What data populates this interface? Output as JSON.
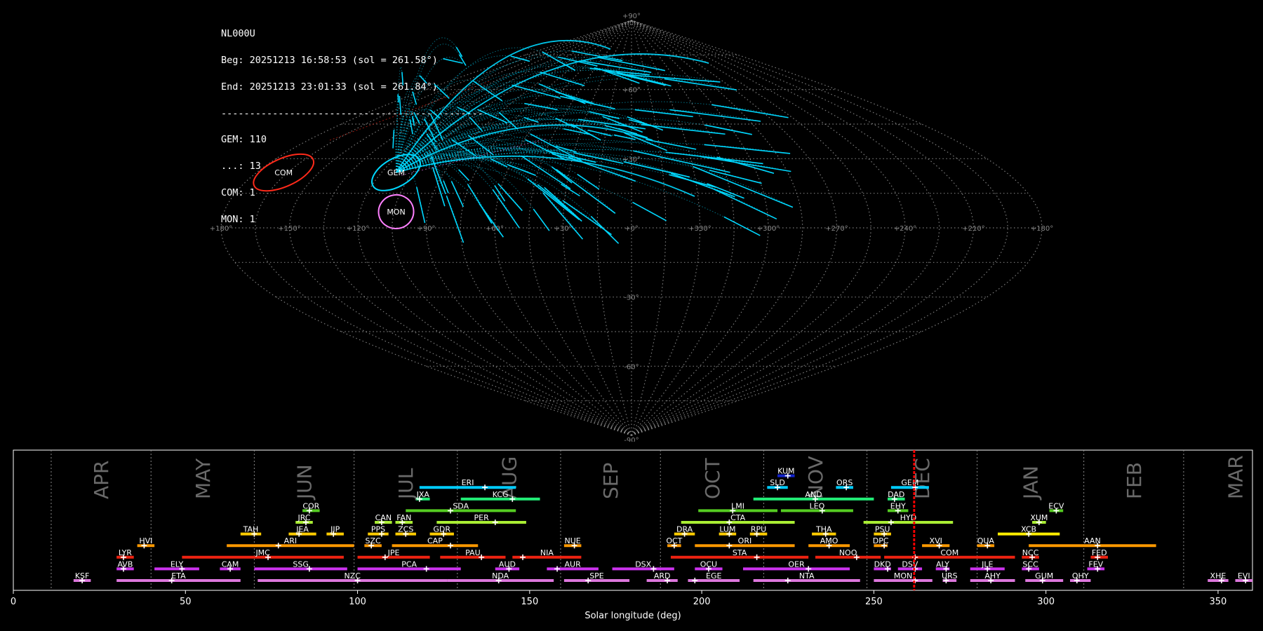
{
  "info": {
    "station": "NL000U",
    "begin": "Beg: 20251213 16:58:53 (sol = 261.58°)",
    "end": "End: 20251213 23:01:33 (sol = 261.84°)",
    "separator": "-----------------------------------------------",
    "counts": [
      "GEM: 110",
      "...: 13",
      "COM: 1",
      "MON: 1"
    ]
  },
  "colors": {
    "background": "#000000",
    "gem": "#00d8ff",
    "com": "#ff2a1a",
    "mon": "#ff80ff",
    "current_sol": "#ff0000",
    "grid": "#9a9a9a"
  },
  "chart_data": [
    {
      "type": "scatter",
      "projection": "sinusoidal",
      "grid": true,
      "lon_tick_labels": [
        "+180°",
        "+150°",
        "+120°",
        "+90°",
        "+60°",
        "+30°",
        "+0°",
        "+330°",
        "+300°",
        "+270°",
        "+240°",
        "+210°",
        "+180°"
      ],
      "lat_tick_labels": [
        "+90°",
        "+60°",
        "+30°",
        "-30°",
        "-60°",
        "-90°"
      ],
      "radiants": [
        {
          "name": "COM",
          "lon": 167,
          "lat": 24
        },
        {
          "name": "GEM",
          "lon": 113,
          "lat": 24
        },
        {
          "name": "MON",
          "lon": 104,
          "lat": 7
        }
      ]
    },
    {
      "type": "timeline",
      "xlabel": "Solar longitude (deg)",
      "xlim": [
        0,
        360
      ],
      "xticks": [
        0,
        50,
        100,
        150,
        200,
        250,
        300,
        350
      ],
      "current_sol": [
        261.58,
        261.84
      ],
      "months": [
        {
          "label": "APR",
          "start": 11
        },
        {
          "label": "MAY",
          "start": 40
        },
        {
          "label": "JUN",
          "start": 70
        },
        {
          "label": "JUL",
          "start": 99
        },
        {
          "label": "AUG",
          "start": 129
        },
        {
          "label": "SEP",
          "start": 159
        },
        {
          "label": "OCT",
          "start": 188
        },
        {
          "label": "NOV",
          "start": 218
        },
        {
          "label": "DEC",
          "start": 248
        },
        {
          "label": "JAN",
          "start": 280
        },
        {
          "label": "FEB",
          "start": 311
        },
        {
          "label": "MAR",
          "start": 340
        }
      ],
      "showers": [
        {
          "code": "KSF",
          "start": 17.5,
          "end": 22.5,
          "peak": 20,
          "row": 0,
          "color": "#dd77dd"
        },
        {
          "code": "ETA",
          "start": 30,
          "end": 66,
          "peak": 46,
          "row": 0,
          "color": "#dd77dd"
        },
        {
          "code": "NZC",
          "start": 71,
          "end": 126,
          "peak": 100,
          "row": 0,
          "color": "#dd77dd"
        },
        {
          "code": "NDA",
          "start": 126,
          "end": 157,
          "peak": 141,
          "row": 0,
          "color": "#dd77dd"
        },
        {
          "code": "SPE",
          "start": 160,
          "end": 179,
          "peak": 167,
          "row": 0,
          "color": "#dd77dd"
        },
        {
          "code": "ARD",
          "start": 184,
          "end": 193,
          "peak": 190,
          "row": 0,
          "color": "#dd77dd"
        },
        {
          "code": "EGE",
          "start": 196,
          "end": 211,
          "peak": 198,
          "row": 0,
          "color": "#dd77dd"
        },
        {
          "code": "NTA",
          "start": 215,
          "end": 246,
          "peak": 225,
          "row": 0,
          "color": "#dd77dd"
        },
        {
          "code": "MON",
          "start": 250,
          "end": 267,
          "peak": 262,
          "row": 0,
          "color": "#dd77dd"
        },
        {
          "code": "URS",
          "start": 270,
          "end": 274,
          "peak": 271,
          "row": 0,
          "color": "#dd77dd"
        },
        {
          "code": "AHY",
          "start": 278,
          "end": 291,
          "peak": 284,
          "row": 0,
          "color": "#dd77dd"
        },
        {
          "code": "GUM",
          "start": 294,
          "end": 305,
          "peak": 299,
          "row": 0,
          "color": "#dd77dd"
        },
        {
          "code": "OHY",
          "start": 307,
          "end": 313,
          "peak": 309,
          "row": 0,
          "color": "#dd77dd"
        },
        {
          "code": "XHE",
          "start": 347,
          "end": 353,
          "peak": 351,
          "row": 0,
          "color": "#dd77dd"
        },
        {
          "code": "EVI",
          "start": 355,
          "end": 360,
          "peak": 358,
          "row": 0,
          "color": "#dd77dd"
        },
        {
          "code": "AVB",
          "start": 30,
          "end": 35,
          "peak": 32,
          "row": 1,
          "color": "#cc33ee"
        },
        {
          "code": "ELY",
          "start": 41,
          "end": 54,
          "peak": 49,
          "row": 1,
          "color": "#cc33ee"
        },
        {
          "code": "CAM",
          "start": 60,
          "end": 66,
          "peak": 63,
          "row": 1,
          "color": "#cc33ee"
        },
        {
          "code": "SSG",
          "start": 70,
          "end": 97,
          "peak": 86,
          "row": 1,
          "color": "#cc33ee"
        },
        {
          "code": "PCA",
          "start": 100,
          "end": 130,
          "peak": 120,
          "row": 1,
          "color": "#cc33ee"
        },
        {
          "code": "AUD",
          "start": 140,
          "end": 147,
          "peak": 144,
          "row": 1,
          "color": "#cc33ee"
        },
        {
          "code": "AUR",
          "start": 155,
          "end": 170,
          "peak": 158,
          "row": 1,
          "color": "#cc33ee"
        },
        {
          "code": "DSX",
          "start": 174,
          "end": 192,
          "peak": 186,
          "row": 1,
          "color": "#cc33ee"
        },
        {
          "code": "OCU",
          "start": 198,
          "end": 206,
          "peak": 202,
          "row": 1,
          "color": "#cc33ee"
        },
        {
          "code": "OER",
          "start": 212,
          "end": 243,
          "peak": 231,
          "row": 1,
          "color": "#cc33ee"
        },
        {
          "code": "DKD",
          "start": 250,
          "end": 255,
          "peak": 254,
          "row": 1,
          "color": "#cc33ee"
        },
        {
          "code": "DSV",
          "start": 257,
          "end": 264,
          "peak": 262,
          "row": 1,
          "color": "#cc33ee"
        },
        {
          "code": "ALY",
          "start": 268,
          "end": 272,
          "peak": 271,
          "row": 1,
          "color": "#cc33ee"
        },
        {
          "code": "JLE",
          "start": 278,
          "end": 288,
          "peak": 283,
          "row": 1,
          "color": "#cc33ee"
        },
        {
          "code": "SCC",
          "start": 293,
          "end": 298,
          "peak": 295,
          "row": 1,
          "color": "#cc33ee"
        },
        {
          "code": "FEV",
          "start": 312,
          "end": 317,
          "peak": 315,
          "row": 1,
          "color": "#cc33ee"
        },
        {
          "code": "LYR",
          "start": 30,
          "end": 35,
          "peak": 32,
          "row": 2,
          "color": "#ee2211"
        },
        {
          "code": "JMC",
          "start": 49,
          "end": 96,
          "peak": 74,
          "row": 2,
          "color": "#ee2211"
        },
        {
          "code": "JPE",
          "start": 100,
          "end": 121,
          "peak": 108,
          "row": 2,
          "color": "#ee2211"
        },
        {
          "code": "PAU",
          "start": 124,
          "end": 143,
          "peak": 136,
          "row": 2,
          "color": "#ee2211"
        },
        {
          "code": "NIA",
          "start": 145,
          "end": 165,
          "peak": 148,
          "row": 2,
          "color": "#ee2211"
        },
        {
          "code": "STA",
          "start": 191,
          "end": 231,
          "peak": 216,
          "row": 2,
          "color": "#ee2211"
        },
        {
          "code": "NOO",
          "start": 233,
          "end": 252,
          "peak": 245,
          "row": 2,
          "color": "#ee2211"
        },
        {
          "code": "COM",
          "start": 253,
          "end": 291,
          "peak": 262,
          "row": 2,
          "color": "#ee2211"
        },
        {
          "code": "NCC",
          "start": 293,
          "end": 298,
          "peak": 296,
          "row": 2,
          "color": "#ee2211"
        },
        {
          "code": "FED",
          "start": 313,
          "end": 318,
          "peak": 315,
          "row": 2,
          "color": "#ee2211"
        },
        {
          "code": "HVI",
          "start": 36,
          "end": 41,
          "peak": 38,
          "row": 3,
          "color": "#ff9900"
        },
        {
          "code": "ARI",
          "start": 62,
          "end": 99,
          "peak": 77,
          "row": 3,
          "color": "#ff9900"
        },
        {
          "code": "SZC",
          "start": 102,
          "end": 107,
          "peak": 104,
          "row": 3,
          "color": "#ff9900"
        },
        {
          "code": "CAP",
          "start": 110,
          "end": 135,
          "peak": 127,
          "row": 3,
          "color": "#ff9900"
        },
        {
          "code": "NUE",
          "start": 160,
          "end": 165,
          "peak": 163,
          "row": 3,
          "color": "#ff9900"
        },
        {
          "code": "OCT",
          "start": 190,
          "end": 194,
          "peak": 192,
          "row": 3,
          "color": "#ff9900"
        },
        {
          "code": "ORI",
          "start": 198,
          "end": 227,
          "peak": 208,
          "row": 3,
          "color": "#ff9900"
        },
        {
          "code": "AMO",
          "start": 231,
          "end": 243,
          "peak": 237,
          "row": 3,
          "color": "#ff9900"
        },
        {
          "code": "DPC",
          "start": 250,
          "end": 254,
          "peak": 253,
          "row": 3,
          "color": "#ff9900"
        },
        {
          "code": "XVI",
          "start": 264,
          "end": 272,
          "peak": 269,
          "row": 3,
          "color": "#ff9900"
        },
        {
          "code": "QUA",
          "start": 280,
          "end": 285,
          "peak": 283,
          "row": 3,
          "color": "#ff9900"
        },
        {
          "code": "AAN",
          "start": 295,
          "end": 332,
          "peak": 315,
          "row": 3,
          "color": "#ff9900"
        },
        {
          "code": "TAH",
          "start": 66,
          "end": 72,
          "peak": 70,
          "row": 4,
          "color": "#ffcc00"
        },
        {
          "code": "JEA",
          "start": 80,
          "end": 88,
          "peak": 83,
          "row": 4,
          "color": "#ffcc00"
        },
        {
          "code": "JIP",
          "start": 91,
          "end": 96,
          "peak": 93,
          "row": 4,
          "color": "#ffcc00"
        },
        {
          "code": "PPS",
          "start": 103,
          "end": 109,
          "peak": 107,
          "row": 4,
          "color": "#ffcc00"
        },
        {
          "code": "ZCS",
          "start": 111,
          "end": 117,
          "peak": 114,
          "row": 4,
          "color": "#ffcc00"
        },
        {
          "code": "GDR",
          "start": 121,
          "end": 128,
          "peak": 125,
          "row": 4,
          "color": "#ffcc00"
        },
        {
          "code": "DRA",
          "start": 192,
          "end": 198,
          "peak": 195,
          "row": 4,
          "color": "#ffcc00"
        },
        {
          "code": "LUM",
          "start": 205,
          "end": 210,
          "peak": 208,
          "row": 4,
          "color": "#ffcc00"
        },
        {
          "code": "RPU",
          "start": 214,
          "end": 219,
          "peak": 216,
          "row": 4,
          "color": "#ffcc00"
        },
        {
          "code": "THA",
          "start": 232,
          "end": 239,
          "peak": 236,
          "row": 4,
          "color": "#ffcc00"
        },
        {
          "code": "PSU",
          "start": 250,
          "end": 255,
          "peak": 253,
          "row": 4,
          "color": "#ffcc00"
        },
        {
          "code": "XCB",
          "start": 286,
          "end": 304,
          "peak": 295,
          "row": 4,
          "color": "#ffee00"
        },
        {
          "code": "JRC",
          "start": 82,
          "end": 87,
          "peak": 85,
          "row": 5,
          "color": "#aaee33"
        },
        {
          "code": "CAN",
          "start": 105,
          "end": 110,
          "peak": 107,
          "row": 5,
          "color": "#aaee33"
        },
        {
          "code": "FAN",
          "start": 111,
          "end": 116,
          "peak": 113,
          "row": 5,
          "color": "#aaee33"
        },
        {
          "code": "PER",
          "start": 123,
          "end": 149,
          "peak": 140,
          "row": 5,
          "color": "#aaee33"
        },
        {
          "code": "CTA",
          "start": 194,
          "end": 227,
          "peak": 208,
          "row": 5,
          "color": "#aaee33"
        },
        {
          "code": "HYD",
          "start": 247,
          "end": 273,
          "peak": 255,
          "row": 5,
          "color": "#aaee33"
        },
        {
          "code": "XUM",
          "start": 296,
          "end": 300,
          "peak": 298,
          "row": 5,
          "color": "#aaee33"
        },
        {
          "code": "COR",
          "start": 84,
          "end": 89,
          "peak": 86,
          "row": 6,
          "color": "#55cc22"
        },
        {
          "code": "SDA",
          "start": 114,
          "end": 146,
          "peak": 127,
          "row": 6,
          "color": "#55cc22"
        },
        {
          "code": "LMI",
          "start": 199,
          "end": 222,
          "peak": 209,
          "row": 6,
          "color": "#55cc22"
        },
        {
          "code": "LEO",
          "start": 223,
          "end": 244,
          "peak": 235,
          "row": 6,
          "color": "#55cc22"
        },
        {
          "code": "EHY",
          "start": 254,
          "end": 260,
          "peak": 257,
          "row": 6,
          "color": "#55cc22"
        },
        {
          "code": "ECV",
          "start": 301,
          "end": 305,
          "peak": 303,
          "row": 6,
          "color": "#55cc22"
        },
        {
          "code": "JXA",
          "start": 117,
          "end": 121,
          "peak": 118,
          "row": 7,
          "color": "#22ee77"
        },
        {
          "code": "KCG",
          "start": 130,
          "end": 153,
          "peak": 145,
          "row": 7,
          "color": "#22ee77"
        },
        {
          "code": "AND",
          "start": 215,
          "end": 250,
          "peak": 233,
          "row": 7,
          "color": "#22ee77"
        },
        {
          "code": "DAD",
          "start": 254,
          "end": 259,
          "peak": 256,
          "row": 7,
          "color": "#22ee77"
        },
        {
          "code": "ERI",
          "start": 118,
          "end": 146,
          "peak": 137,
          "row": 8,
          "color": "#00ccff"
        },
        {
          "code": "SLD",
          "start": 219,
          "end": 225,
          "peak": 222,
          "row": 8,
          "color": "#00ccff"
        },
        {
          "code": "ORS",
          "start": 239,
          "end": 244,
          "peak": 242,
          "row": 8,
          "color": "#00ccff"
        },
        {
          "code": "GEM",
          "start": 255,
          "end": 266,
          "peak": 262,
          "row": 8,
          "color": "#00ccff"
        },
        {
          "code": "KUM",
          "start": 222,
          "end": 227,
          "peak": 225,
          "row": 9,
          "color": "#1122cc"
        }
      ]
    }
  ]
}
